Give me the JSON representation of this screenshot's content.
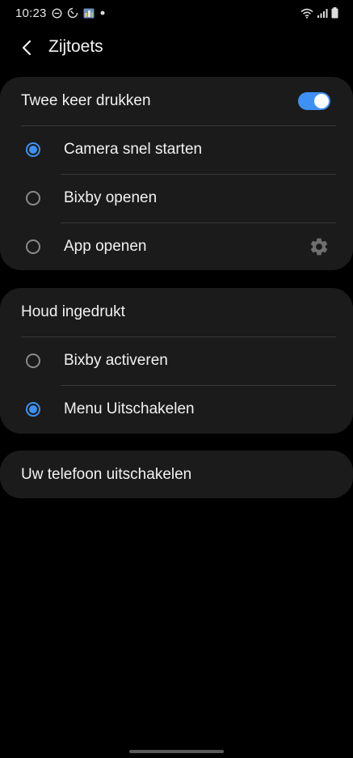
{
  "status_bar": {
    "time": "10:23",
    "left_icons": [
      "do-not-disturb-icon",
      "sync-icon",
      "gallery-icon",
      "dot-icon"
    ],
    "right_icons": [
      "wifi-icon",
      "signal-icon",
      "battery-icon"
    ]
  },
  "header": {
    "title": "Zijtoets",
    "back_icon": "chevron-left-icon"
  },
  "double_press": {
    "label": "Twee keer drukken",
    "enabled": true,
    "options": [
      {
        "label": "Camera snel starten",
        "selected": true
      },
      {
        "label": "Bixby openen",
        "selected": false
      },
      {
        "label": "App openen",
        "selected": false,
        "settings_icon": "gear-icon"
      }
    ]
  },
  "press_hold": {
    "label": "Houd ingedrukt",
    "options": [
      {
        "label": "Bixby activeren",
        "selected": false
      },
      {
        "label": "Menu Uitschakelen",
        "selected": true
      }
    ]
  },
  "power_off": {
    "label": "Uw telefoon uitschakelen"
  },
  "colors": {
    "accent": "#3e91f2",
    "background": "#000000",
    "card": "#1b1b1b",
    "divider": "#383838",
    "text": "#f2f2f2"
  }
}
